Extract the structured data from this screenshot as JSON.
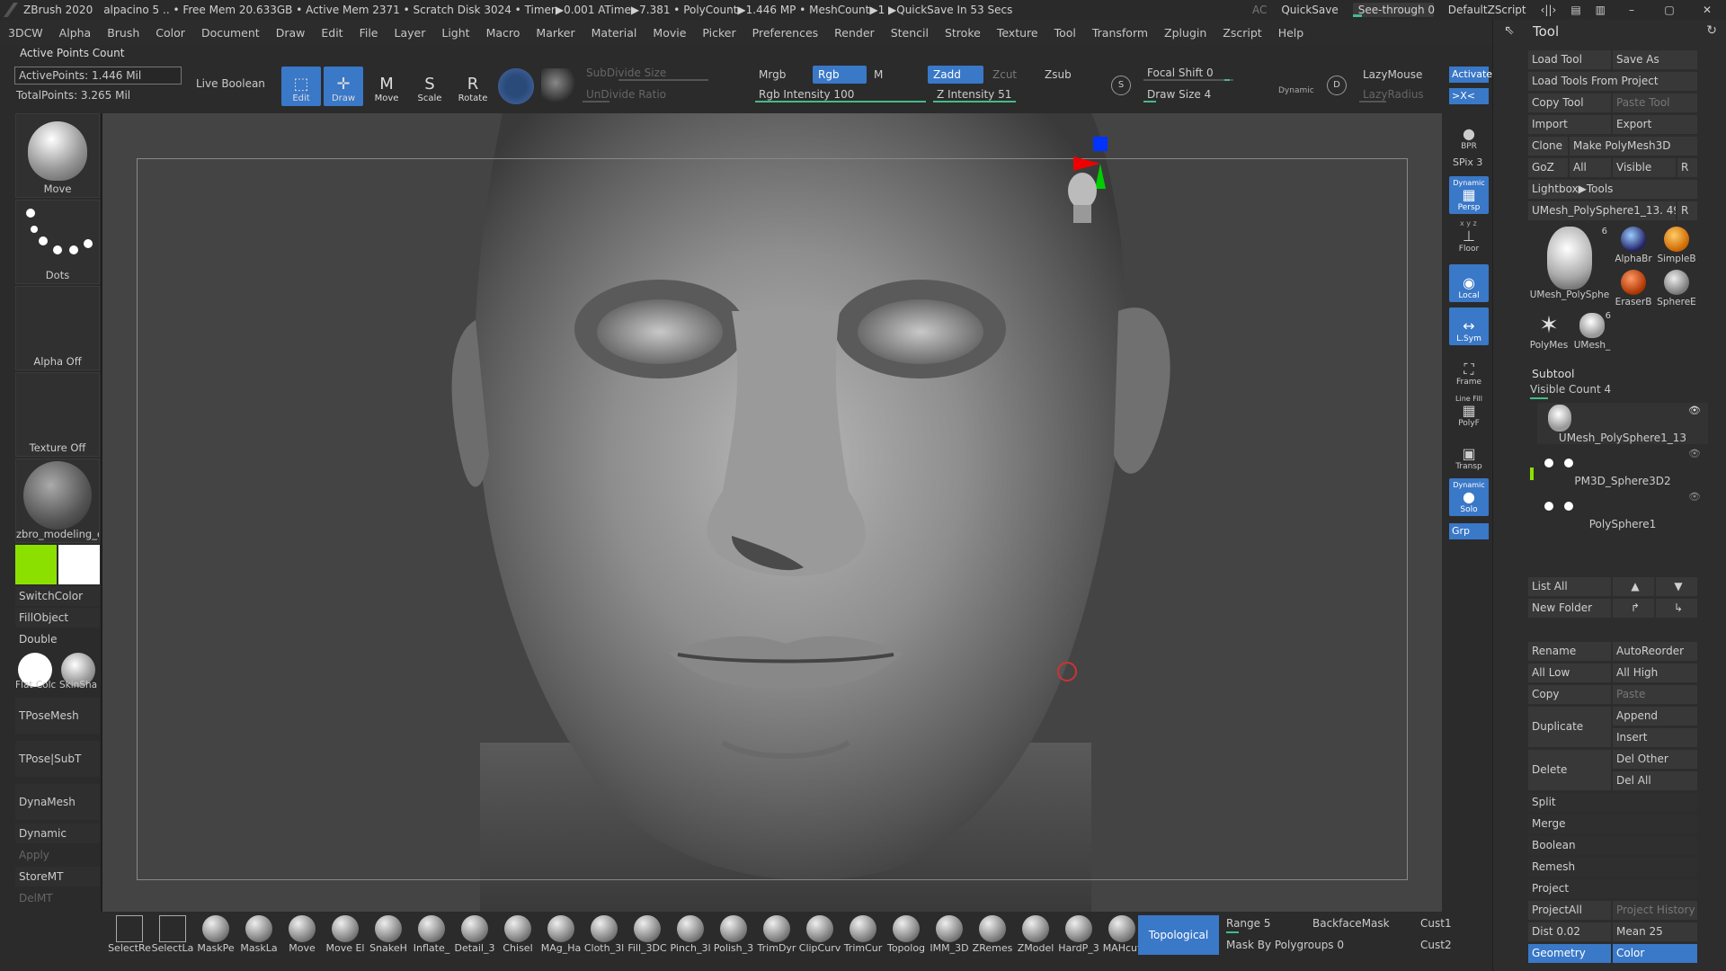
{
  "titlebar": {
    "app": "ZBrush 2020",
    "info": "alpacino 5  .. • Free Mem 20.633GB • Active Mem 2371 • Scratch Disk 3024 • Timer▶0.001 ATime▶7.381 • PolyCount▶1.446 MP • MeshCount▶1  ▶QuickSave In 53 Secs",
    "ac": "AC",
    "quicksave": "QuickSave",
    "see_through": "See-through  0",
    "default_zscript": "DefaultZScript",
    "win_min": "–",
    "win_max": "▢",
    "win_close": "✕"
  },
  "menu": [
    "3DCW",
    "Alpha",
    "Brush",
    "Color",
    "Document",
    "Draw",
    "Edit",
    "File",
    "Layer",
    "Light",
    "Macro",
    "Marker",
    "Material",
    "Movie",
    "Picker",
    "Preferences",
    "Render",
    "Stencil",
    "Stroke",
    "Texture",
    "Tool",
    "Transform",
    "Zplugin",
    "Zscript",
    "Help"
  ],
  "top": {
    "active_points_title": "Active Points Count",
    "active_points": "ActivePoints: 1.446 Mil",
    "total_points": "TotalPoints: 3.265 Mil",
    "live_boolean": "Live Boolean",
    "edit": "Edit",
    "draw": "Draw",
    "move": "Move",
    "scale": "Scale",
    "rotate": "Rotate",
    "subdivide_size": "SubDivide Size",
    "undivide_ratio": "UnDivide Ratio",
    "mrgb": "Mrgb",
    "rgb": "Rgb",
    "m": "M",
    "rgb_intensity": "Rgb Intensity 100",
    "zadd": "Zadd",
    "zcut": "Zcut",
    "zsub": "Zsub",
    "z_intensity": "Z Intensity 51",
    "focal_shift": "Focal Shift 0",
    "draw_size": "Draw Size 4",
    "dynamic": "Dynamic",
    "lazymouse": "LazyMouse",
    "lazyradius": "LazyRadius",
    "s_label": "S",
    "d_label": "D"
  },
  "left": {
    "brush_label": "Move",
    "stroke_label": "Dots",
    "alpha_label": "Alpha Off",
    "texture_label": "Texture Off",
    "material_label": "zbro_modeling_c",
    "switch_color": "SwitchColor",
    "fill_object": "FillObject",
    "double": "Double",
    "flat_color": "Flat Colc",
    "skin_shade": "SkinSha",
    "tpose_mesh": "TPoseMesh",
    "tpose_subt": "TPose|SubT",
    "dynamesh": "DynaMesh",
    "dynamic": "Dynamic",
    "apply": "Apply",
    "store_mt": "StoreMT",
    "del_mt": "DelMT",
    "main_color": "#8ce000",
    "secondary_color": "#ffffff"
  },
  "right_shelf": {
    "activate": "Activate",
    "xc": ">X<",
    "bpr": "BPR",
    "spix": "SPix 3",
    "persp": "Persp",
    "persp_top": "Dynamic",
    "xyz": "x y z",
    "floor": "Floor",
    "local": "Local",
    "lsym": "L.Sym",
    "frame": "Frame",
    "linefill": "Line Fill",
    "polyf": "PolyF",
    "transp": "Transp",
    "solo": "Solo",
    "solo_top": "Dynamic",
    "grp": "Grp"
  },
  "tool": {
    "title": "Tool",
    "load_tool": "Load Tool",
    "save_as": "Save As",
    "load_from_project": "Load Tools From Project",
    "copy_tool": "Copy Tool",
    "paste_tool": "Paste Tool",
    "import": "Import",
    "export": "Export",
    "clone": "Clone",
    "make_polymesh": "Make PolyMesh3D",
    "goz": "GoZ",
    "all": "All",
    "visible": "Visible",
    "r": "R",
    "lightbox_tools": "Lightbox▶Tools",
    "current_tool": "UMesh_PolySphere1_13. 49",
    "thumbs": [
      {
        "label": "UMesh_PolySphe",
        "count": "6"
      },
      {
        "label": "AlphaBr"
      },
      {
        "label": "SimpleB"
      },
      {
        "label": "EraserB"
      },
      {
        "label": "SphereE"
      },
      {
        "label": "PolyMes"
      },
      {
        "label": "UMesh_",
        "count": "6"
      }
    ],
    "subtool_title": "Subtool",
    "visible_count": "Visible Count 4",
    "subtools": [
      "UMesh_PolySphere1_13",
      "PM3D_Sphere3D2",
      "PolySphere1"
    ],
    "list_all": "List All",
    "new_folder": "New Folder",
    "rename": "Rename",
    "autoreorder": "AutoReorder",
    "all_low": "All Low",
    "all_high": "All High",
    "copy": "Copy",
    "paste": "Paste",
    "duplicate": "Duplicate",
    "append": "Append",
    "insert": "Insert",
    "delete": "Delete",
    "del_other": "Del Other",
    "del_all": "Del All",
    "split": "Split",
    "merge": "Merge",
    "boolean": "Boolean",
    "remesh": "Remesh",
    "project": "Project",
    "project_all": "ProjectAll",
    "project_history": "Project History",
    "dist": "Dist 0.02",
    "mean": "Mean 25",
    "geometry": "Geometry",
    "color": "Color"
  },
  "bottom": {
    "brushes": [
      "SelectRe",
      "SelectLa",
      "MaskPe",
      "MaskLa",
      "Move",
      "Move El",
      "SnakeH",
      "Inflate_",
      "Detail_3",
      "Chisel",
      "MAg_Ha",
      "Cloth_3l",
      "Fill_3DC",
      "Pinch_3l",
      "Polish_3",
      "TrimDyr",
      "ClipCurv",
      "TrimCur",
      "Topolog",
      "IMM_3D",
      "ZRemes",
      "ZModel",
      "HardP_3",
      "MAHcut"
    ],
    "topological": "Topological",
    "range": "Range 5",
    "backface_mask": "BackfaceMask",
    "mask_by_polygroups": "Mask By Polygroups 0",
    "cust1": "Cust1",
    "cust2": "Cust2"
  }
}
